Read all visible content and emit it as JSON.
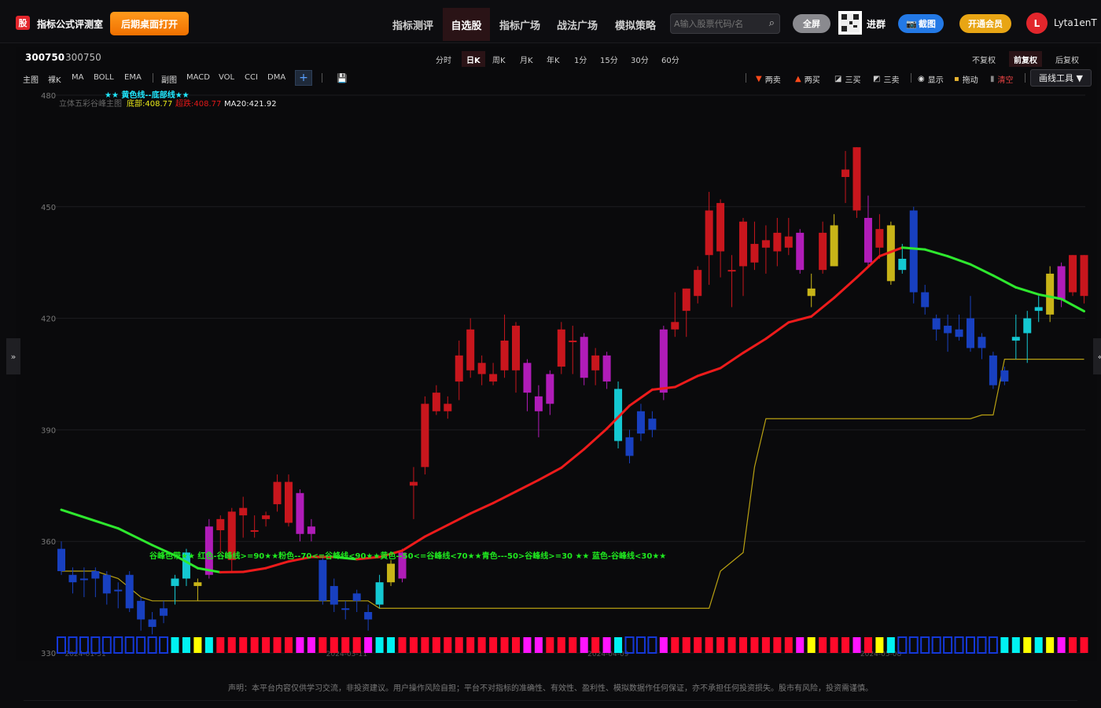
{
  "app": {
    "logo_text": "股",
    "title": "指标公式评测室",
    "open_desktop": "后期桌面打开"
  },
  "nav": [
    {
      "label": "指标测评"
    },
    {
      "label": "自选股"
    },
    {
      "label": "指标广场"
    },
    {
      "label": "战法广场"
    },
    {
      "label": "模拟策略"
    }
  ],
  "search": {
    "placeholder": "A输入股票代码/名"
  },
  "header_buttons": {
    "fullscreen": "全屏",
    "join_group": "进群",
    "screenshot": "截图",
    "vip": "开通会员"
  },
  "user": {
    "avatar_letter": "L",
    "name": "Lyta1enT"
  },
  "stock": {
    "code": "300750",
    "name": "300750"
  },
  "periods": [
    "分时",
    "日K",
    "周K",
    "月K",
    "年K",
    "1分",
    "15分",
    "30分",
    "60分"
  ],
  "active_period": "日K",
  "adjust": [
    "不复权",
    "前复权",
    "后复权"
  ],
  "indicator_tabs": {
    "main_label": "主图",
    "main_items": [
      "裸K",
      "MA",
      "BOLL",
      "EMA"
    ],
    "sub_label": "副图",
    "sub_items": [
      "MACD",
      "VOL",
      "CCI",
      "DMA"
    ],
    "plus": "+"
  },
  "tools": {
    "two_sell": "两卖",
    "two_buy": "两买",
    "three_buy": "三买",
    "three_sell": "三卖",
    "show": "显示",
    "drag": "拖动",
    "clear": "清空",
    "draw_tools": "画线工具 ▼"
  },
  "chart_info": {
    "formula_name": "立体五彩谷峰主图",
    "bottom_label": "底部:408.77",
    "jump_label": "超跌:408.77",
    "ma_label": "MA20:421.92",
    "top_legend": "★★ 黄色线--底部线★★",
    "band_legend": "谷峰色带★★ 红色-谷峰线>=90★★粉色--70<=谷峰线<90★★黄色--50<=谷峰线<70★★青色---50>谷峰线>=30 ★★ 蓝色-谷峰线<30★★"
  },
  "side": {
    "left": "»",
    "right": "«"
  },
  "disclaimer": "声明：本平台内容仅供学习交流，非投资建议。用户操作风险自担；平台不对指标的准确性、有效性、盈利性、模拟数据作任何保证，亦不承担任何投资损失。股市有风险，投资需谨慎。",
  "colors": {
    "red": "#c8161d",
    "magenta": "#b01cb8",
    "yellow": "#c8b418",
    "cyan": "#14c8d2",
    "blue": "#1840c0",
    "ma_green": "#2ee82e",
    "ma_red": "#ee1b1b",
    "bottom_line": "#b8a012",
    "band_red": "#ff0a2a",
    "band_pink": "#ff14ff",
    "band_yellow": "#ffff00",
    "band_cyan": "#00f2f2",
    "band_blue": "#1438d8"
  },
  "chart_data": {
    "type": "candlestick",
    "ylim": [
      330,
      480
    ],
    "yticks": [
      330,
      360,
      390,
      420,
      450,
      480
    ],
    "x_labels": [
      "2024-01-31",
      "2024-03-11",
      "2024-04-09",
      "2024-05-08"
    ],
    "candles": [
      {
        "o": 358,
        "c": 352,
        "h": 360,
        "l": 351,
        "k": "b"
      },
      {
        "o": 351,
        "c": 349,
        "h": 353,
        "l": 346,
        "k": "b"
      },
      {
        "o": 350,
        "c": 350,
        "h": 353,
        "l": 345,
        "k": "b"
      },
      {
        "o": 352,
        "c": 350,
        "h": 353,
        "l": 345,
        "k": "b"
      },
      {
        "o": 351,
        "c": 346,
        "h": 352,
        "l": 343,
        "k": "b"
      },
      {
        "o": 347,
        "c": 347,
        "h": 349,
        "l": 342,
        "k": "b"
      },
      {
        "o": 351,
        "c": 342,
        "h": 352,
        "l": 341,
        "k": "b"
      },
      {
        "o": 344,
        "c": 339,
        "h": 345,
        "l": 336,
        "k": "b"
      },
      {
        "o": 339,
        "c": 337,
        "h": 341,
        "l": 335,
        "k": "b"
      },
      {
        "o": 340,
        "c": 342,
        "h": 344,
        "l": 338,
        "k": "b"
      },
      {
        "o": 348,
        "c": 350,
        "h": 351,
        "l": 343,
        "k": "c"
      },
      {
        "o": 350,
        "c": 357,
        "h": 358,
        "l": 348,
        "k": "c"
      },
      {
        "o": 349,
        "c": 348,
        "h": 350,
        "l": 344,
        "k": "y"
      },
      {
        "o": 351,
        "c": 364,
        "h": 366,
        "l": 350,
        "k": "m"
      },
      {
        "o": 363,
        "c": 366,
        "h": 367,
        "l": 357,
        "k": "r"
      },
      {
        "o": 355,
        "c": 368,
        "h": 369,
        "l": 352,
        "k": "r"
      },
      {
        "o": 367,
        "c": 369,
        "h": 372,
        "l": 361,
        "k": "r"
      },
      {
        "o": 363,
        "c": 363,
        "h": 367,
        "l": 361,
        "k": "r"
      },
      {
        "o": 367,
        "c": 366,
        "h": 368,
        "l": 364,
        "k": "r"
      },
      {
        "o": 370,
        "c": 376,
        "h": 378,
        "l": 368,
        "k": "r"
      },
      {
        "o": 365,
        "c": 376,
        "h": 378,
        "l": 364,
        "k": "r"
      },
      {
        "o": 362,
        "c": 373,
        "h": 374,
        "l": 360,
        "k": "m"
      },
      {
        "o": 364,
        "c": 362,
        "h": 366,
        "l": 360,
        "k": "m"
      },
      {
        "o": 355,
        "c": 344,
        "h": 356,
        "l": 343,
        "k": "b"
      },
      {
        "o": 348,
        "c": 343,
        "h": 350,
        "l": 341,
        "k": "b"
      },
      {
        "o": 342,
        "c": 342,
        "h": 344,
        "l": 339,
        "k": "b"
      },
      {
        "o": 346,
        "c": 344,
        "h": 347,
        "l": 341,
        "k": "b"
      },
      {
        "o": 341,
        "c": 339,
        "h": 343,
        "l": 336,
        "k": "b"
      },
      {
        "o": 343,
        "c": 349,
        "h": 351,
        "l": 342,
        "k": "c"
      },
      {
        "o": 349,
        "c": 354,
        "h": 355,
        "l": 348,
        "k": "y"
      },
      {
        "o": 350,
        "c": 357,
        "h": 358,
        "l": 349,
        "k": "m"
      },
      {
        "o": 375,
        "c": 376,
        "h": 380,
        "l": 366,
        "k": "r"
      },
      {
        "o": 380,
        "c": 397,
        "h": 399,
        "l": 378,
        "k": "r"
      },
      {
        "o": 395,
        "c": 400,
        "h": 402,
        "l": 394,
        "k": "r"
      },
      {
        "o": 395,
        "c": 397,
        "h": 399,
        "l": 393,
        "k": "r"
      },
      {
        "o": 403,
        "c": 410,
        "h": 414,
        "l": 398,
        "k": "r"
      },
      {
        "o": 406,
        "c": 417,
        "h": 420,
        "l": 404,
        "k": "r"
      },
      {
        "o": 405,
        "c": 408,
        "h": 410,
        "l": 402,
        "k": "r"
      },
      {
        "o": 403,
        "c": 405,
        "h": 408,
        "l": 402,
        "k": "r"
      },
      {
        "o": 406,
        "c": 414,
        "h": 421,
        "l": 404,
        "k": "r"
      },
      {
        "o": 406,
        "c": 418,
        "h": 419,
        "l": 400,
        "k": "r"
      },
      {
        "o": 408,
        "c": 400,
        "h": 409,
        "l": 395,
        "k": "m"
      },
      {
        "o": 399,
        "c": 395,
        "h": 402,
        "l": 388,
        "k": "m"
      },
      {
        "o": 397,
        "c": 405,
        "h": 406,
        "l": 394,
        "k": "m"
      },
      {
        "o": 407,
        "c": 417,
        "h": 419,
        "l": 405,
        "k": "r"
      },
      {
        "o": 414,
        "c": 414,
        "h": 418,
        "l": 405,
        "k": "r"
      },
      {
        "o": 415,
        "c": 404,
        "h": 416,
        "l": 402,
        "k": "m"
      },
      {
        "o": 410,
        "c": 406,
        "h": 412,
        "l": 402,
        "k": "r"
      },
      {
        "o": 410,
        "c": 403,
        "h": 411,
        "l": 401,
        "k": "m"
      },
      {
        "o": 401,
        "c": 387,
        "h": 403,
        "l": 385,
        "k": "c"
      },
      {
        "o": 388,
        "c": 383,
        "h": 390,
        "l": 381,
        "k": "b"
      },
      {
        "o": 395,
        "c": 389,
        "h": 397,
        "l": 387,
        "k": "b"
      },
      {
        "o": 393,
        "c": 390,
        "h": 395,
        "l": 388,
        "k": "b"
      },
      {
        "o": 417,
        "c": 400,
        "h": 418,
        "l": 398,
        "k": "m"
      },
      {
        "o": 417,
        "c": 419,
        "h": 427,
        "l": 415,
        "k": "r"
      },
      {
        "o": 422,
        "c": 428,
        "h": 428,
        "l": 415,
        "k": "r"
      },
      {
        "o": 426,
        "c": 433,
        "h": 434,
        "l": 424,
        "k": "r"
      },
      {
        "o": 437,
        "c": 449,
        "h": 454,
        "l": 429,
        "k": "r"
      },
      {
        "o": 438,
        "c": 451,
        "h": 452,
        "l": 431,
        "k": "r"
      },
      {
        "o": 433,
        "c": 433,
        "h": 437,
        "l": 423,
        "k": "r"
      },
      {
        "o": 434,
        "c": 446,
        "h": 447,
        "l": 426,
        "k": "r"
      },
      {
        "o": 435,
        "c": 440,
        "h": 446,
        "l": 433,
        "k": "r"
      },
      {
        "o": 439,
        "c": 441,
        "h": 445,
        "l": 432,
        "k": "r"
      },
      {
        "o": 438,
        "c": 443,
        "h": 447,
        "l": 434,
        "k": "r"
      },
      {
        "o": 442,
        "c": 439,
        "h": 447,
        "l": 437,
        "k": "r"
      },
      {
        "o": 443,
        "c": 433,
        "h": 444,
        "l": 432,
        "k": "m"
      },
      {
        "o": 428,
        "c": 426,
        "h": 432,
        "l": 423,
        "k": "y"
      },
      {
        "o": 433,
        "c": 443,
        "h": 446,
        "l": 432,
        "k": "r"
      },
      {
        "o": 434,
        "c": 445,
        "h": 448,
        "l": 434,
        "k": "y"
      },
      {
        "o": 458,
        "c": 460,
        "h": 465,
        "l": 451,
        "k": "r"
      },
      {
        "o": 449,
        "c": 466,
        "h": 466,
        "l": 447,
        "k": "r"
      },
      {
        "o": 447,
        "c": 435,
        "h": 453,
        "l": 434,
        "k": "m"
      },
      {
        "o": 444,
        "c": 439,
        "h": 448,
        "l": 436,
        "k": "r"
      },
      {
        "o": 445,
        "c": 430,
        "h": 446,
        "l": 429,
        "k": "y"
      },
      {
        "o": 433,
        "c": 436,
        "h": 440,
        "l": 432,
        "k": "c"
      },
      {
        "o": 449,
        "c": 427,
        "h": 450,
        "l": 424,
        "k": "b"
      },
      {
        "o": 427,
        "c": 423,
        "h": 429,
        "l": 421,
        "k": "b"
      },
      {
        "o": 420,
        "c": 417,
        "h": 421,
        "l": 414,
        "k": "b"
      },
      {
        "o": 418,
        "c": 416,
        "h": 421,
        "l": 411,
        "k": "b"
      },
      {
        "o": 417,
        "c": 415,
        "h": 421,
        "l": 414,
        "k": "b"
      },
      {
        "o": 420,
        "c": 412,
        "h": 426,
        "l": 411,
        "k": "b"
      },
      {
        "o": 415,
        "c": 412,
        "h": 416,
        "l": 409,
        "k": "b"
      },
      {
        "o": 410,
        "c": 402,
        "h": 411,
        "l": 401,
        "k": "b"
      },
      {
        "o": 406,
        "c": 403,
        "h": 407,
        "l": 402,
        "k": "b"
      },
      {
        "o": 415,
        "c": 414,
        "h": 421,
        "l": 409,
        "k": "c"
      },
      {
        "o": 416,
        "c": 420,
        "h": 422,
        "l": 408,
        "k": "c"
      },
      {
        "o": 422,
        "c": 423,
        "h": 426,
        "l": 419,
        "k": "c"
      },
      {
        "o": 421,
        "c": 432,
        "h": 434,
        "l": 419,
        "k": "y"
      },
      {
        "o": 425,
        "c": 434,
        "h": 435,
        "l": 423,
        "k": "m"
      },
      {
        "o": 427,
        "c": 437,
        "h": 437,
        "l": 426,
        "k": "r"
      },
      {
        "o": 426,
        "c": 437,
        "h": 437,
        "l": 424,
        "k": "r"
      }
    ],
    "ma20": [
      {
        "i": 0,
        "v": 368.5
      },
      {
        "i": 5,
        "v": 363.5
      },
      {
        "i": 8,
        "v": 359
      },
      {
        "i": 10,
        "v": 356.2
      },
      {
        "i": 12,
        "v": 352.8
      },
      {
        "i": 14,
        "v": 351.7
      },
      {
        "i": 16,
        "v": 351.8
      },
      {
        "i": 18,
        "v": 352.8
      },
      {
        "i": 20,
        "v": 354.6
      },
      {
        "i": 22,
        "v": 355.8
      },
      {
        "i": 24,
        "v": 355.8
      },
      {
        "i": 26,
        "v": 355.2
      },
      {
        "i": 28,
        "v": 355.8
      },
      {
        "i": 30,
        "v": 357.5
      },
      {
        "i": 32,
        "v": 361.3
      },
      {
        "i": 34,
        "v": 364.4
      },
      {
        "i": 36,
        "v": 367.5
      },
      {
        "i": 38,
        "v": 370.3
      },
      {
        "i": 40,
        "v": 373.4
      },
      {
        "i": 42,
        "v": 376.5
      },
      {
        "i": 44,
        "v": 379.8
      },
      {
        "i": 46,
        "v": 384.8
      },
      {
        "i": 48,
        "v": 390.3
      },
      {
        "i": 50,
        "v": 396.5
      },
      {
        "i": 52,
        "v": 400.8
      },
      {
        "i": 54,
        "v": 401.5
      },
      {
        "i": 56,
        "v": 404.5
      },
      {
        "i": 58,
        "v": 406.6
      },
      {
        "i": 60,
        "v": 410.7
      },
      {
        "i": 62,
        "v": 414.5
      },
      {
        "i": 64,
        "v": 418.9
      },
      {
        "i": 66,
        "v": 420.5
      },
      {
        "i": 68,
        "v": 425.5
      },
      {
        "i": 70,
        "v": 431
      },
      {
        "i": 72,
        "v": 436.7
      },
      {
        "i": 74,
        "v": 439
      },
      {
        "i": 76,
        "v": 438.5
      },
      {
        "i": 78,
        "v": 436.7
      },
      {
        "i": 80,
        "v": 434.5
      },
      {
        "i": 82,
        "v": 431.5
      },
      {
        "i": 84,
        "v": 428.3
      },
      {
        "i": 86,
        "v": 426.4
      },
      {
        "i": 88,
        "v": 425.2
      },
      {
        "i": 90,
        "v": 421.9
      }
    ],
    "bottom_line": [
      {
        "i": 0,
        "v": 352
      },
      {
        "i": 3,
        "v": 352
      },
      {
        "i": 5,
        "v": 350
      },
      {
        "i": 7,
        "v": 345
      },
      {
        "i": 8,
        "v": 344
      },
      {
        "i": 27,
        "v": 344
      },
      {
        "i": 28,
        "v": 342
      },
      {
        "i": 57,
        "v": 342
      },
      {
        "i": 58,
        "v": 352
      },
      {
        "i": 60,
        "v": 357
      },
      {
        "i": 61,
        "v": 380
      },
      {
        "i": 62,
        "v": 393
      },
      {
        "i": 80,
        "v": 393
      },
      {
        "i": 81,
        "v": 394
      },
      {
        "i": 82,
        "v": 394
      },
      {
        "i": 83,
        "v": 409
      },
      {
        "i": 90,
        "v": 409
      }
    ],
    "band": [
      "b",
      "b",
      "b",
      "b",
      "b",
      "b",
      "b",
      "b",
      "b",
      "b",
      "c",
      "c",
      "y",
      "c",
      "r",
      "r",
      "r",
      "r",
      "r",
      "r",
      "r",
      "p",
      "p",
      "r",
      "r",
      "r",
      "r",
      "p",
      "c",
      "c",
      "r",
      "r",
      "r",
      "r",
      "r",
      "r",
      "r",
      "r",
      "r",
      "r",
      "r",
      "p",
      "p",
      "r",
      "r",
      "r",
      "p",
      "r",
      "p",
      "c",
      "b",
      "b",
      "b",
      "p",
      "r",
      "r",
      "r",
      "r",
      "r",
      "r",
      "r",
      "r",
      "r",
      "r",
      "r",
      "p",
      "y",
      "r",
      "r",
      "r",
      "p",
      "r",
      "y",
      "c",
      "b",
      "b",
      "b",
      "b",
      "b",
      "b",
      "b",
      "b",
      "b",
      "c",
      "c",
      "y",
      "c",
      "y",
      "p",
      "r",
      "r"
    ]
  }
}
